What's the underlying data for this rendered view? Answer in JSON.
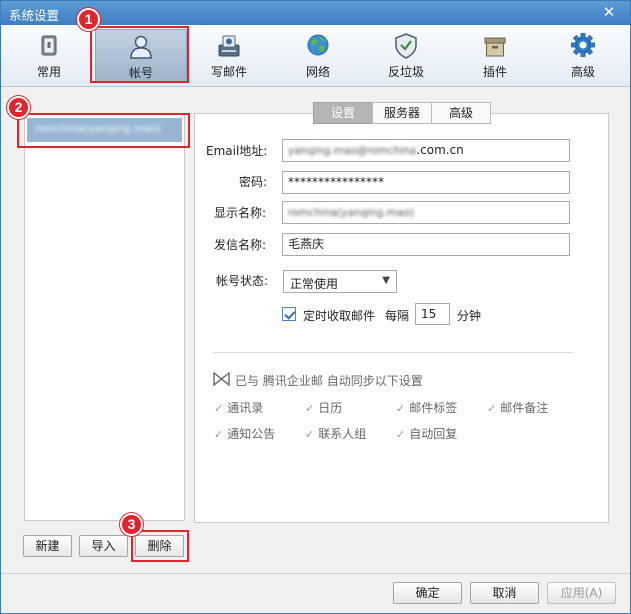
{
  "window": {
    "title": "系统设置",
    "close_icon": "close-icon"
  },
  "toolbar": {
    "items": [
      {
        "label": "常用",
        "icon": "general-icon"
      },
      {
        "label": "帐号",
        "icon": "account-icon"
      },
      {
        "label": "写邮件",
        "icon": "compose-icon"
      },
      {
        "label": "网络",
        "icon": "globe-icon"
      },
      {
        "label": "反垃圾",
        "icon": "shield-icon"
      },
      {
        "label": "插件",
        "icon": "plugin-box-icon"
      },
      {
        "label": "高级",
        "icon": "gear-icon"
      }
    ],
    "active_index": 1
  },
  "annotations": {
    "badge1": "1",
    "badge2": "2",
    "badge3": "3",
    "color": "#e0242b"
  },
  "accounts": {
    "items": [
      {
        "label": "romchina(yanqing.mao)"
      }
    ]
  },
  "tabs": [
    {
      "label": "设置"
    },
    {
      "label": "服务器"
    },
    {
      "label": "高级"
    }
  ],
  "form": {
    "email_label": "Email地址:",
    "email_value_blurred": "yanqing.mao@romchina",
    "email_value_suffix": ".com.cn",
    "password_label": "密码:",
    "password_value": "****************",
    "display_name_label": "显示名称:",
    "display_name_value": "romchina(yanqing.mao)",
    "sender_name_label": "发信名称:",
    "sender_name_value": "毛燕庆",
    "status_label": "帐号状态:",
    "status_value": "正常使用",
    "auto_fetch_label": "定时收取邮件",
    "interval_prefix": "每隔",
    "interval_value": "15",
    "interval_unit": "分钟"
  },
  "sync": {
    "header_prefix": "已与",
    "header_service": "腾讯企业邮",
    "header_suffix": "自动同步以下设置",
    "items": [
      "通讯录",
      "日历",
      "邮件标签",
      "邮件备注",
      "通知公告",
      "联系人组",
      "自动回复"
    ]
  },
  "left_buttons": {
    "new": "新建",
    "import": "导入",
    "delete": "删除"
  },
  "bottom_buttons": {
    "ok": "确定",
    "cancel": "取消",
    "apply": "应用(A)"
  }
}
